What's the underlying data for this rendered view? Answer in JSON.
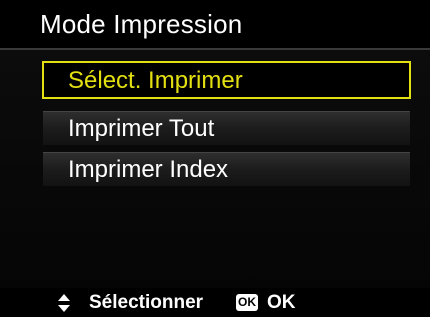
{
  "header": {
    "title": "Mode Impression"
  },
  "menu": {
    "items": [
      {
        "label": "Sélect. Imprimer",
        "selected": true
      },
      {
        "label": "Imprimer Tout",
        "selected": false
      },
      {
        "label": "Imprimer Index",
        "selected": false
      }
    ]
  },
  "footer": {
    "navigate_icon": "up-down-arrows-icon",
    "select_label": "Sélectionner",
    "ok_icon_text": "OK",
    "ok_label": "OK"
  },
  "colors": {
    "highlight": "#e3e011",
    "background": "#000000",
    "text": "#ffffff"
  }
}
